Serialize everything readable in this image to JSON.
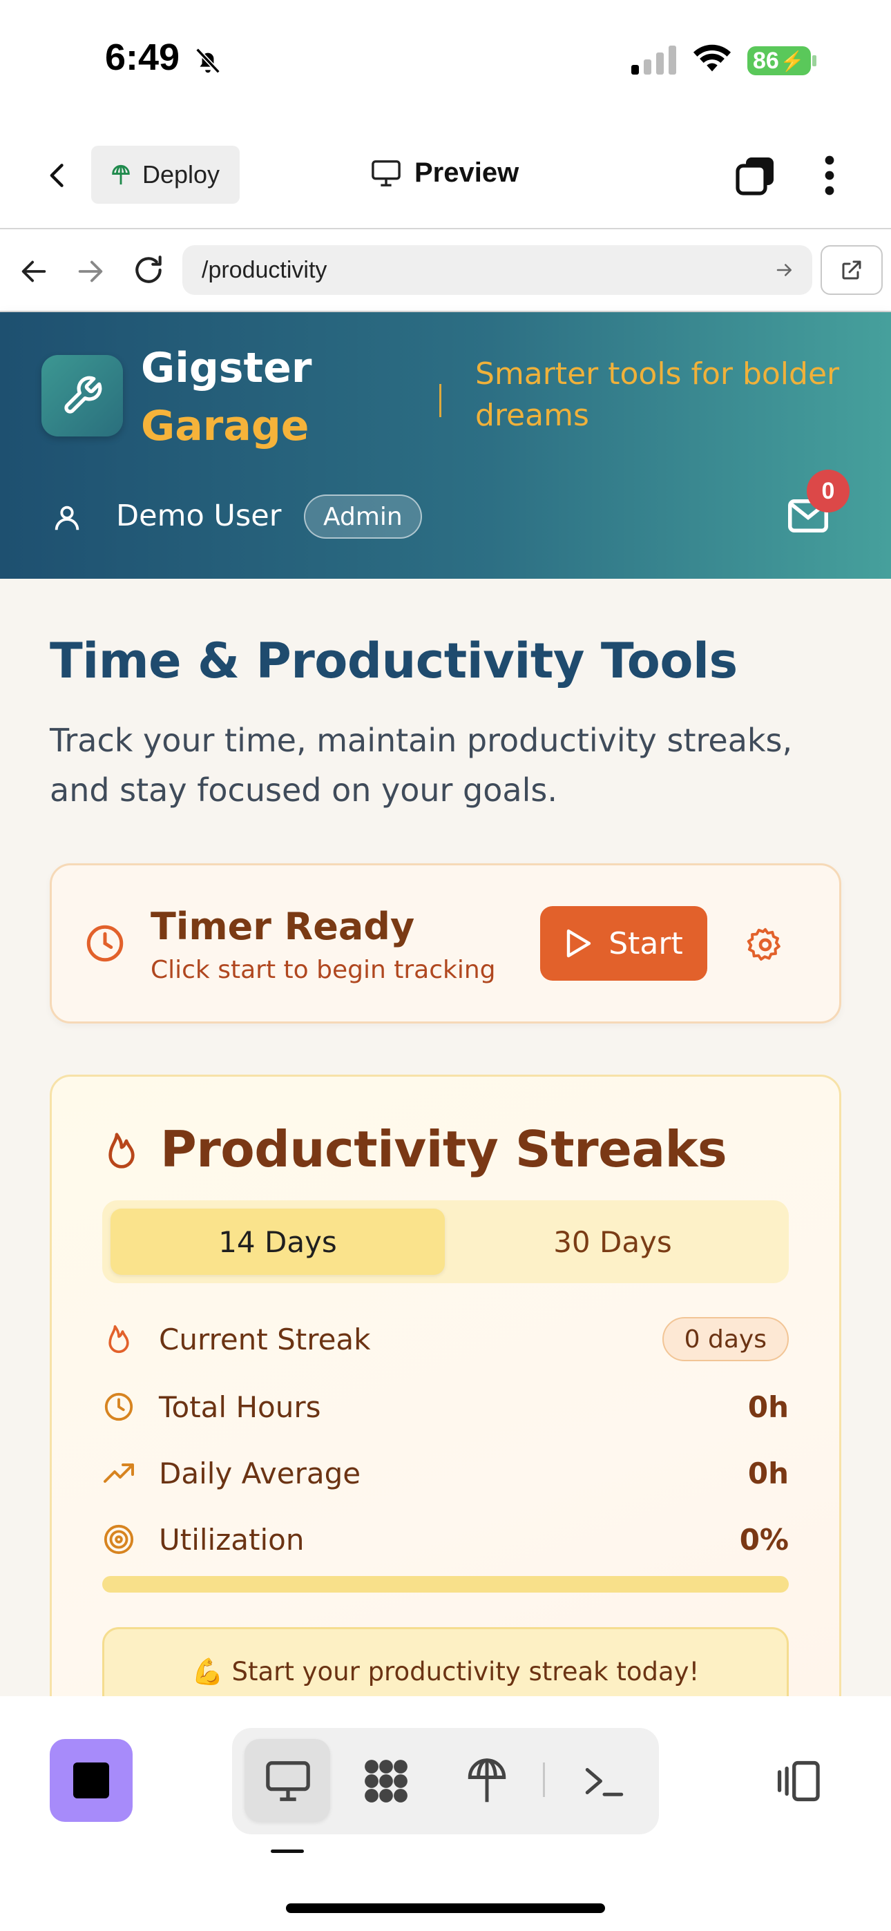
{
  "status_bar": {
    "time": "6:49",
    "battery": "86"
  },
  "replit_header": {
    "deploy_label": "Deploy",
    "title": "Preview"
  },
  "url_bar": {
    "url": "/productivity"
  },
  "app_header": {
    "brand_line1": "Gigster",
    "brand_line2": "Garage",
    "tagline": "Smarter tools for bolder dreams",
    "user_name": "Demo User",
    "role_badge": "Admin",
    "mail_count": "0"
  },
  "page": {
    "title": "Time & Productivity Tools",
    "subtitle": "Track your time, maintain productivity streaks, and stay focused on your goals."
  },
  "timer": {
    "title": "Timer Ready",
    "subtitle": "Click start to begin tracking",
    "start_label": "Start"
  },
  "streaks": {
    "title": "Productivity Streaks",
    "tabs": [
      {
        "label": "14 Days",
        "active": true
      },
      {
        "label": "30 Days",
        "active": false
      }
    ],
    "stats": [
      {
        "icon": "flame-icon",
        "label": "Current Streak",
        "value": "0 days"
      },
      {
        "icon": "clock-icon",
        "label": "Total Hours",
        "value": "0h"
      },
      {
        "icon": "trending-up-icon",
        "label": "Daily Average",
        "value": "0h"
      },
      {
        "icon": "target-icon",
        "label": "Utilization",
        "value": "0%"
      }
    ],
    "utilization_progress": 0,
    "motivation": "💪 Start your productivity streak today!"
  },
  "colors": {
    "accent_orange": "#e2612b",
    "header_teal": "#2d6f84",
    "brand_gold": "#f6b33a",
    "title_navy": "#1f4b6e",
    "stop_purple": "#a78bfa"
  }
}
